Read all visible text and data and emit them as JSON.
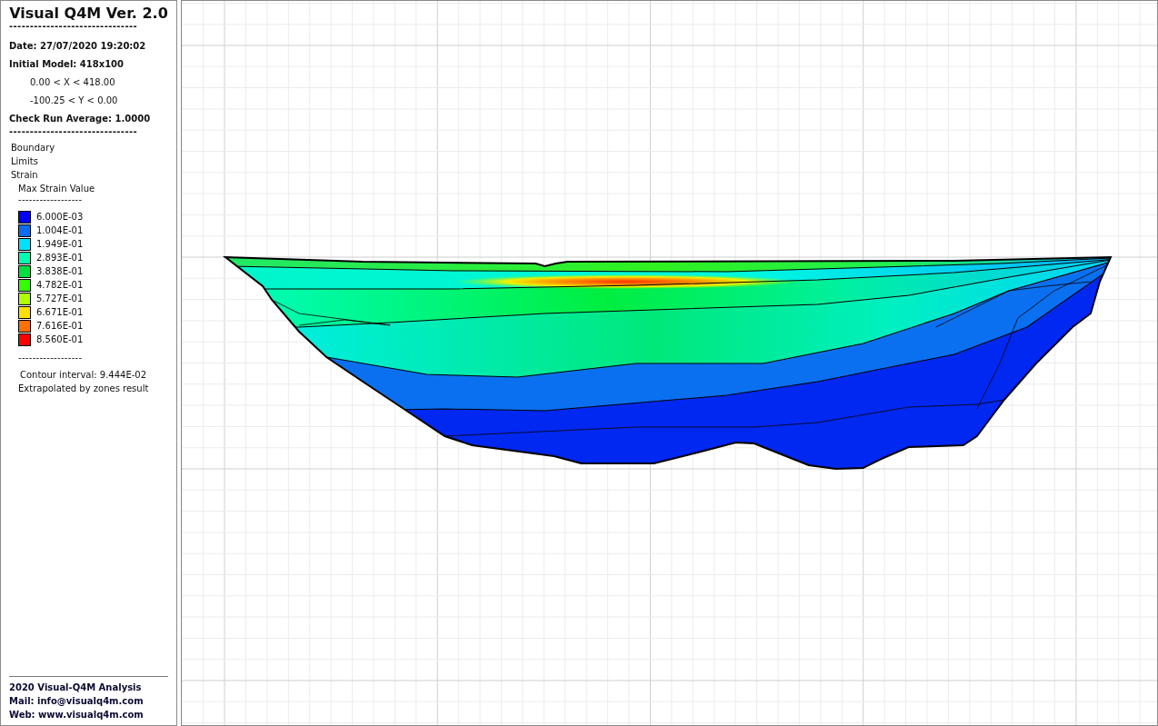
{
  "sidebar": {
    "title": "Visual Q4M Ver. 2.0",
    "title_rule": "-------------------------------",
    "info": [
      {
        "text": "Date: 27/07/2020 19:20:02",
        "kind": "heading"
      },
      {
        "text": "Initial Model: 418x100",
        "kind": "heading"
      },
      {
        "text": "0.00 < X < 418.00",
        "kind": "range"
      },
      {
        "text": "-100.25 < Y < 0.00",
        "kind": "range"
      },
      {
        "text": "Check Run Average: 1.0000",
        "kind": "heading"
      }
    ],
    "info_rule": "-------------------------------",
    "layers": [
      "Boundary",
      "Limits",
      "Strain"
    ],
    "variable": "Max Strain Value",
    "legend_rule_top": "------------------",
    "legend": [
      {
        "label": "6.000E-03",
        "color": "#0000ff"
      },
      {
        "label": "1.004E-01",
        "color": "#0a6cf5"
      },
      {
        "label": "1.949E-01",
        "color": "#00e0ff"
      },
      {
        "label": "2.893E-01",
        "color": "#00ffb0"
      },
      {
        "label": "3.838E-01",
        "color": "#00e040"
      },
      {
        "label": "4.782E-01",
        "color": "#33ff00"
      },
      {
        "label": "5.727E-01",
        "color": "#b0ff00"
      },
      {
        "label": "6.671E-01",
        "color": "#ffe000"
      },
      {
        "label": "7.616E-01",
        "color": "#ff7000"
      },
      {
        "label": "8.560E-01",
        "color": "#ff0000"
      }
    ],
    "legend_rule_bottom": "------------------",
    "contour_interval": "Contour interval: 9.444E-02",
    "note": "Extrapolated by zones result",
    "footer": [
      "2020 Visual-Q4M Analysis",
      "Mail: info@visualq4m.com",
      "Web: www.visualq4m.com"
    ]
  }
}
